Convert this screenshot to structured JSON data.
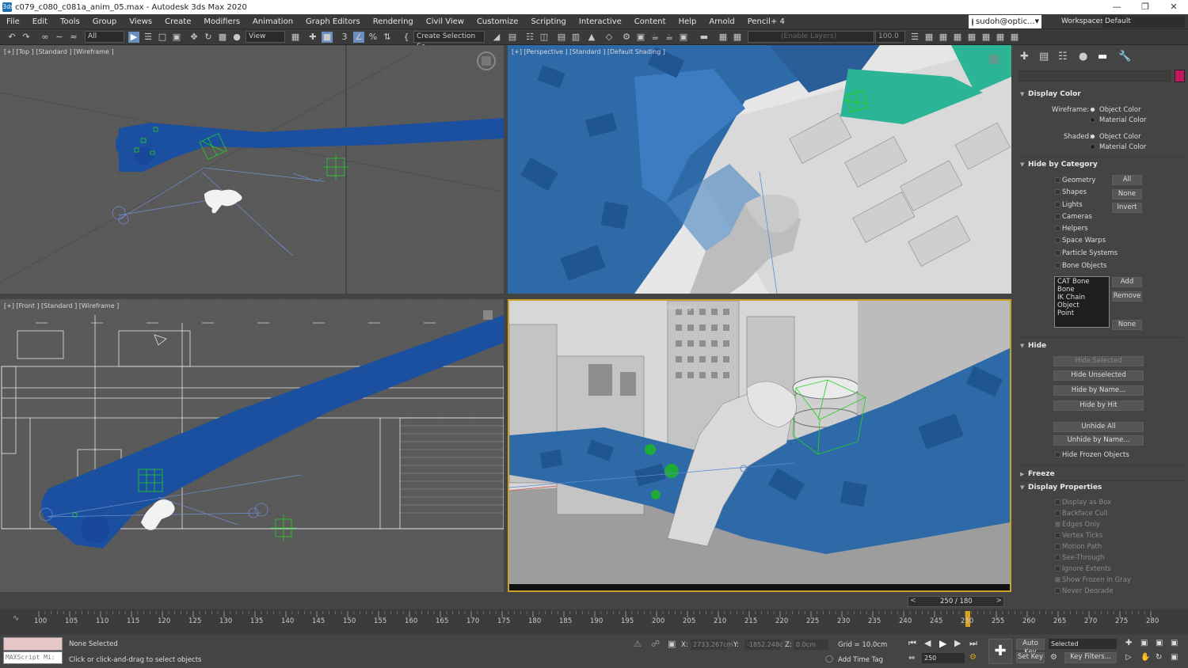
{
  "window": {
    "title": "c079_c080_c081a_anim_05.max - Autodesk 3ds Max 2020",
    "app_icon": "3ds"
  },
  "menu": [
    "File",
    "Edit",
    "Tools",
    "Group",
    "Views",
    "Create",
    "Modifiers",
    "Animation",
    "Graph Editors",
    "Rendering",
    "Civil View",
    "Customize",
    "Scripting",
    "Interactive",
    "Content",
    "Help",
    "Arnold",
    "Pencil+ 4"
  ],
  "user": "sudoh@optic...",
  "workspace": {
    "label": "Workspaces:",
    "value": "Default"
  },
  "toolbar": {
    "filter": "All",
    "refcoord": "View",
    "selection_set": "Create Selection Se",
    "layer": "(Enable Layers)",
    "spin": "100.0"
  },
  "viewports": {
    "top": "[+] [Top ] [Standard ] [Wireframe ]",
    "perspective": "[+] [Perspective ] [Standard ] [Default Shading ]",
    "front": "[+] [Front ] [Standard ] [Wireframe ]",
    "camera": "[+] [cam_c081a_198-290 ] [Standard ] [Default Shading ]"
  },
  "command_panel": {
    "tab_icons": [
      "create-icon",
      "modify-icon",
      "hierarchy-icon",
      "motion-icon",
      "display-icon",
      "utilities-icon"
    ],
    "accent": "#c2185b",
    "display_color": {
      "title": "Display Color",
      "wireframe_label": "Wireframe:",
      "shaded_label": "Shaded:",
      "object_color": "Object Color",
      "material_color": "Material Color"
    },
    "hide_by_category": {
      "title": "Hide by Category",
      "items": [
        "Geometry",
        "Shapes",
        "Lights",
        "Cameras",
        "Helpers",
        "Space Warps",
        "Particle Systems",
        "Bone Objects"
      ],
      "all": "All",
      "none": "None",
      "invert": "Invert",
      "list": [
        "CAT Bone",
        "Bone",
        "IK Chain Object",
        "Point"
      ],
      "add": "Add",
      "remove": "Remove",
      "none2": "None"
    },
    "hide": {
      "title": "Hide",
      "buttons": [
        "Hide Selected",
        "Hide Unselected",
        "Hide by Name...",
        "Hide by Hit",
        "Unhide All",
        "Unhide by Name..."
      ],
      "frozen": "Hide Frozen Objects"
    },
    "freeze": {
      "title": "Freeze"
    },
    "display_properties": {
      "title": "Display Properties",
      "items": [
        "Display as Box",
        "Backface Cull",
        "Edges Only",
        "Vertex Ticks",
        "Motion Path",
        "See-Through",
        "Ignore Extents",
        "Show Frozen in Gray",
        "Never Degrade"
      ]
    }
  },
  "time_slider": {
    "value": "250 / 180"
  },
  "trackbar": {
    "ticks": [
      "100",
      "105",
      "110",
      "115",
      "120",
      "125",
      "130",
      "135",
      "140",
      "145",
      "150",
      "155",
      "160",
      "165",
      "170",
      "175",
      "180",
      "185",
      "190",
      "195",
      "200",
      "205",
      "210",
      "215",
      "220",
      "225",
      "230",
      "235",
      "240",
      "245",
      "250",
      "255",
      "260",
      "265",
      "270",
      "275",
      "280"
    ]
  },
  "status": {
    "maxscript": "MAXScript Mi:",
    "selection": "None Selected",
    "prompt": "Click or click-and-drag to select objects",
    "x_label": "X:",
    "x": "2733.267cm",
    "y_label": "Y:",
    "y": "-1852.248c",
    "z_label": "Z:",
    "z": "0.0cm",
    "grid": "Grid = 10.0cm",
    "add_time_tag": "Add Time Tag",
    "frame": "250",
    "auto_key": "Auto Key",
    "set_key": "Set Key",
    "selected": "Selected",
    "key_filters": "Key Filters..."
  }
}
